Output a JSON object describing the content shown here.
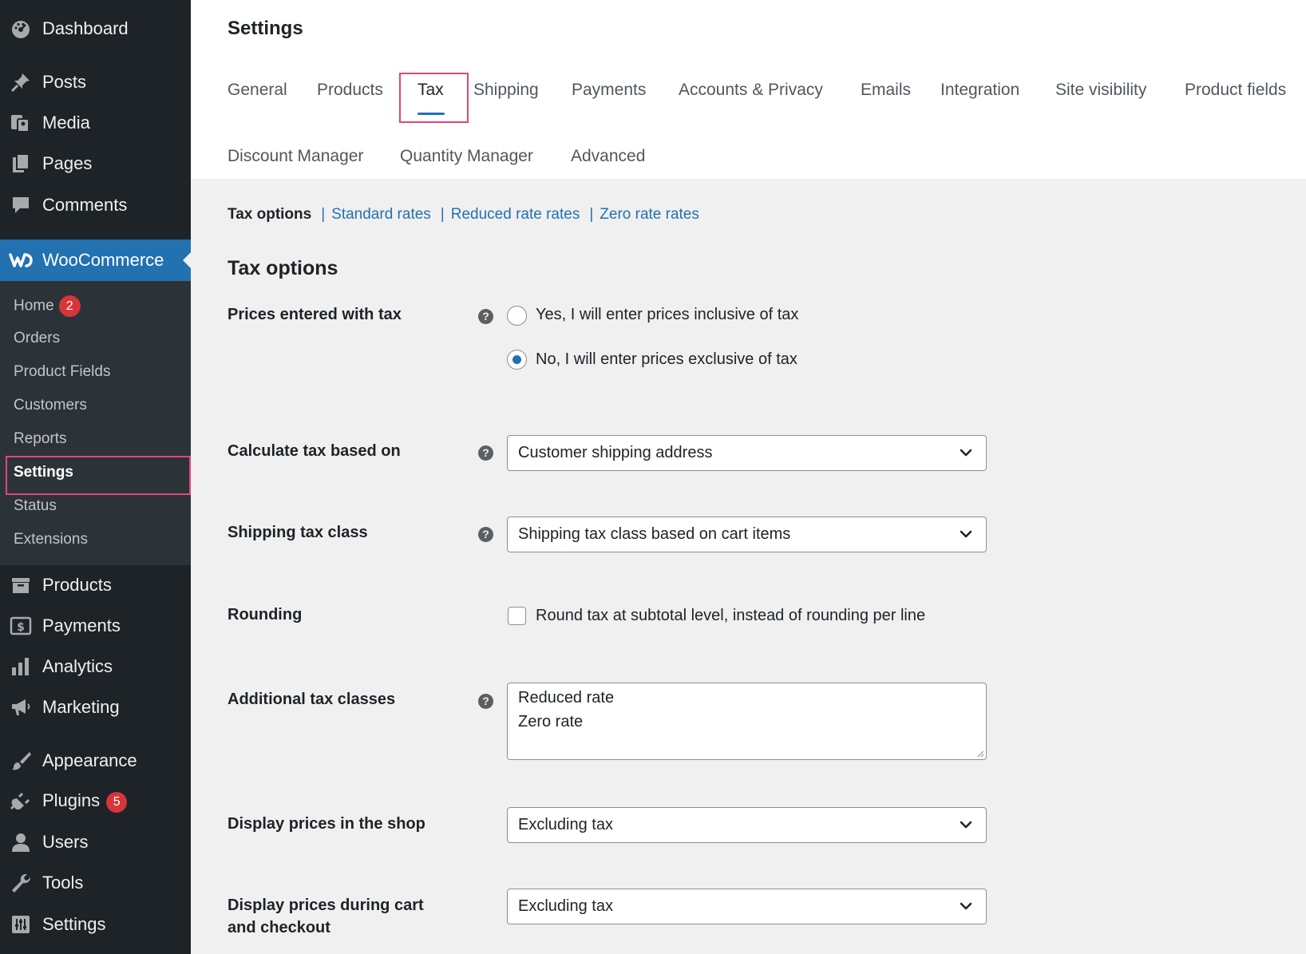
{
  "sidebar": {
    "top_items": [
      {
        "label": "Dashboard",
        "icon": "dashboard-icon"
      },
      {
        "label": "Posts",
        "icon": "pin-icon"
      },
      {
        "label": "Media",
        "icon": "media-icon"
      },
      {
        "label": "Pages",
        "icon": "pages-icon"
      },
      {
        "label": "Comments",
        "icon": "comment-icon"
      }
    ],
    "woocommerce": {
      "label": "WooCommerce",
      "icon": "woocommerce-icon"
    },
    "submenu": [
      {
        "label": "Home",
        "count": "2"
      },
      {
        "label": "Orders"
      },
      {
        "label": "Product Fields"
      },
      {
        "label": "Customers"
      },
      {
        "label": "Reports"
      },
      {
        "label": "Settings",
        "current": true
      },
      {
        "label": "Status"
      },
      {
        "label": "Extensions"
      }
    ],
    "bottom_items": [
      {
        "label": "Products",
        "icon": "archive-icon"
      },
      {
        "label": "Payments",
        "icon": "dollar-icon"
      },
      {
        "label": "Analytics",
        "icon": "bar-chart-icon"
      },
      {
        "label": "Marketing",
        "icon": "megaphone-icon"
      },
      {
        "label": "Appearance",
        "icon": "paintbrush-icon"
      },
      {
        "label": "Plugins",
        "icon": "plug-icon",
        "count": "5"
      },
      {
        "label": "Users",
        "icon": "user-icon"
      },
      {
        "label": "Tools",
        "icon": "wrench-icon"
      },
      {
        "label": "Settings",
        "icon": "sliders-icon"
      }
    ]
  },
  "header": {
    "title": "Settings"
  },
  "tabs": {
    "row1": [
      "General",
      "Products",
      "Tax",
      "Shipping",
      "Payments",
      "Accounts & Privacy",
      "Emails",
      "Integration",
      "Site visibility",
      "Product fields"
    ],
    "row2": [
      "Discount Manager",
      "Quantity Manager",
      "Advanced"
    ],
    "active": "Tax"
  },
  "subnav": {
    "current": "Tax options",
    "links": [
      "Standard rates",
      "Reduced rate rates",
      "Zero rate rates"
    ],
    "separator": "|"
  },
  "section": {
    "title": "Tax options"
  },
  "fields": {
    "prices_entered": {
      "label": "Prices entered with tax",
      "options": [
        "Yes, I will enter prices inclusive of tax",
        "No, I will enter prices exclusive of tax"
      ],
      "selected": "No, I will enter prices exclusive of tax"
    },
    "calculate_based_on": {
      "label": "Calculate tax based on",
      "value": "Customer shipping address"
    },
    "shipping_tax_class": {
      "label": "Shipping tax class",
      "value": "Shipping tax class based on cart items"
    },
    "rounding": {
      "label": "Rounding",
      "checkbox_label": "Round tax at subtotal level, instead of rounding per line",
      "checked": false
    },
    "additional_classes": {
      "label": "Additional tax classes",
      "lines": [
        "Reduced rate",
        "Zero rate"
      ]
    },
    "display_shop": {
      "label": "Display prices in the shop",
      "value": "Excluding tax"
    },
    "display_cart": {
      "label_line1": "Display prices during cart",
      "label_line2": "and checkout",
      "value": "Excluding tax"
    }
  },
  "help_glyph": "?",
  "colors": {
    "sidebar_bg": "#1d2327",
    "submenu_bg": "#2c3338",
    "accent": "#2271b1",
    "badge": "#d63638",
    "highlight": "#e2457a"
  }
}
